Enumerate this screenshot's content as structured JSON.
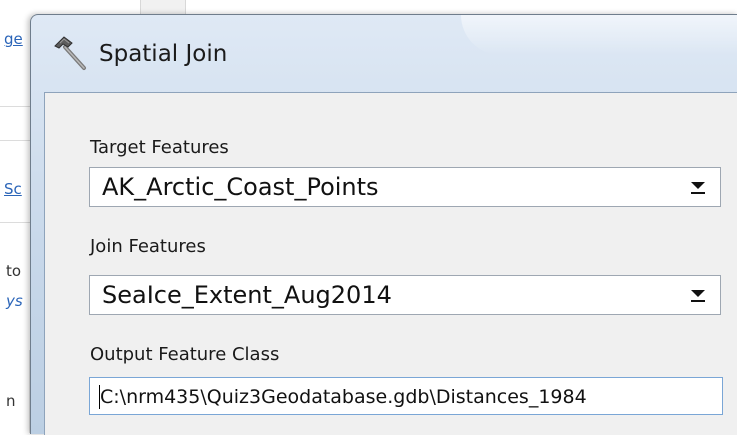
{
  "background": {
    "top_fragment_left": "",
    "top_fragment_right": "",
    "links": [
      {
        "text": "ge"
      },
      {
        "text": "Sc"
      }
    ],
    "texts": [
      {
        "text": "to"
      },
      {
        "text": "ys"
      },
      {
        "text": "n"
      }
    ]
  },
  "dialog": {
    "title": "Spatial Join",
    "title_icon": "hammer-icon",
    "fields": {
      "target_features": {
        "label": "Target Features",
        "value": "AK_Arctic_Coast_Points",
        "arrow_icon": "dropdown-arrow-icon"
      },
      "join_features": {
        "label": "Join Features",
        "value": "SeaIce_Extent_Aug2014",
        "arrow_icon": "dropdown-arrow-icon"
      },
      "output_feature_class": {
        "label": "Output Feature Class",
        "value": "C:\\nrm435\\Quiz3Geodatabase.gdb\\Distances_1984"
      }
    }
  },
  "colors": {
    "titlebar": "#c8d8ea",
    "client_bg": "#f0f0f0",
    "link": "#2a64b8",
    "input_focus_border": "#7aa6d6"
  }
}
